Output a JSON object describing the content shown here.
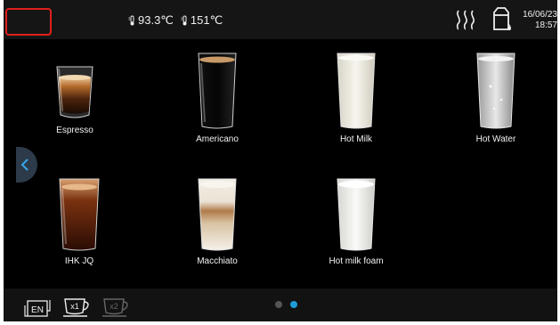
{
  "status": {
    "temp1": "93.3℃",
    "temp2": "151℃",
    "date": "16/06/23",
    "time": "18:57"
  },
  "drinks": [
    {
      "label": "Espresso"
    },
    {
      "label": "Americano"
    },
    {
      "label": "Hot Milk"
    },
    {
      "label": "Hot Water"
    },
    {
      "label": "IHK JQ"
    },
    {
      "label": "Macchiato"
    },
    {
      "label": "Hot milk foam"
    }
  ],
  "bottom": {
    "language": "EN",
    "single_cup": "x1",
    "double_cup": "x2"
  },
  "pagination": {
    "pages": 2,
    "current": 2
  },
  "colors": {
    "selection_outline": "#e0201c",
    "active_dot": "#1e9bd7",
    "background": "#000000"
  }
}
